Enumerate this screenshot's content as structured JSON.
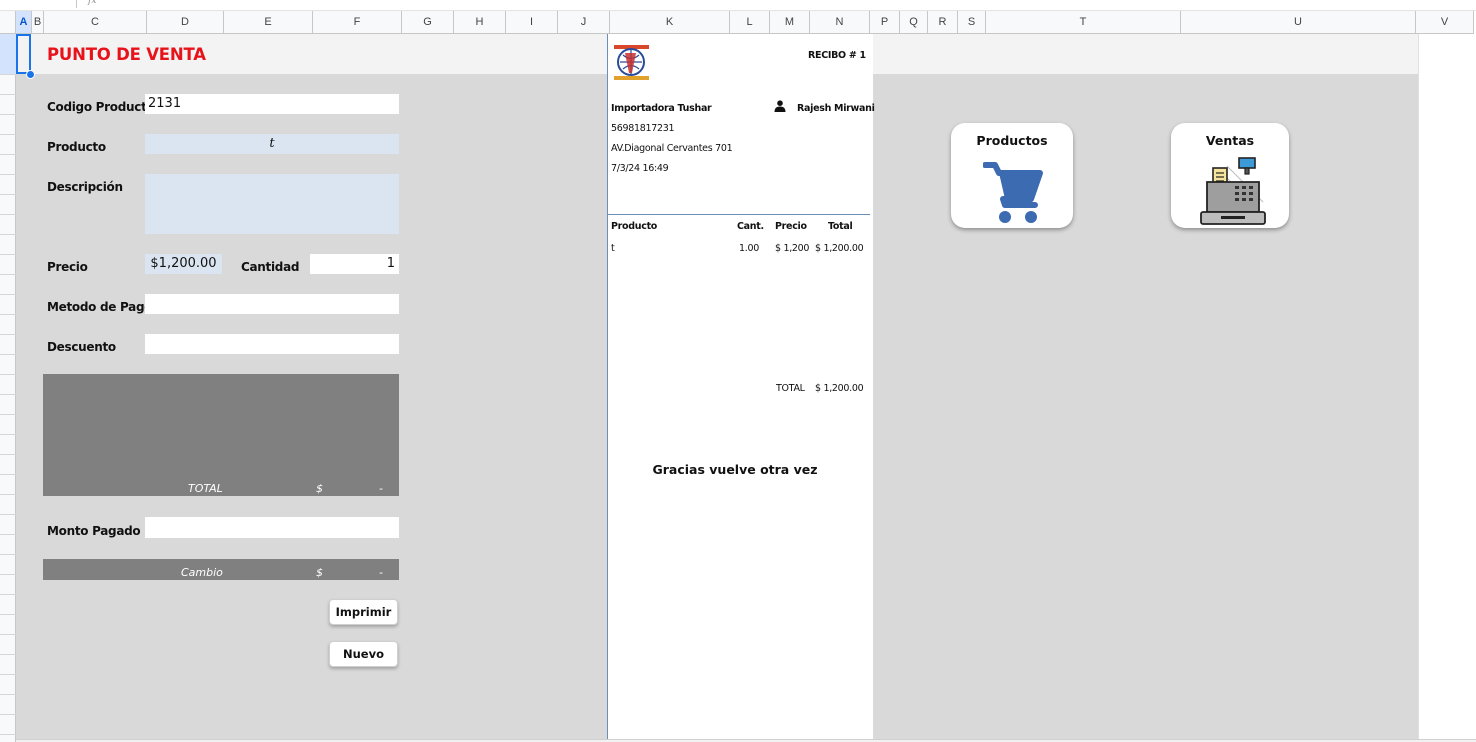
{
  "formula_bar": {
    "fx_label": "fx"
  },
  "columns": [
    "A",
    "B",
    "C",
    "D",
    "E",
    "F",
    "G",
    "H",
    "I",
    "J",
    "K",
    "L",
    "M",
    "N",
    "P",
    "Q",
    "R",
    "S",
    "T",
    "U",
    "V"
  ],
  "form": {
    "title": "PUNTO DE VENTA",
    "codigo_label": "Codigo Producto",
    "codigo_value": "2131",
    "producto_label": "Producto",
    "producto_value": "t",
    "descripcion_label": "Descripción",
    "descripcion_value": "",
    "precio_label": "Precio",
    "precio_value": "$1,200.00",
    "cantidad_label": "Cantidad",
    "cantidad_value": "1",
    "metodo_label": "Metodo de Pago",
    "metodo_value": "",
    "descuento_label": "Descuento",
    "descuento_value": "",
    "total_label": "TOTAL",
    "total_currency": "$",
    "total_value": "-",
    "monto_label": "Monto Pagado",
    "monto_value": "",
    "cambio_label": "Cambio",
    "cambio_currency": "$",
    "cambio_value": "-",
    "imprimir_label": "Imprimir",
    "nuevo_label": "Nuevo"
  },
  "receipt": {
    "recibo": "RECIBO # 1",
    "company": "Importadora Tushar",
    "phone": "56981817231",
    "address": "AV.Diagonal Cervantes 701",
    "datetime": "7/3/24 16:49",
    "user": "Rajesh Mirwani",
    "headers": {
      "producto": "Producto",
      "cant": "Cant.",
      "precio": "Precio",
      "total": "Total"
    },
    "items": [
      {
        "producto": "t",
        "cant": "1.00",
        "precio": "$ 1,200",
        "total": "$ 1,200.00"
      }
    ],
    "total_label": "TOTAL",
    "total_value": "$ 1,200.00",
    "thanks": "Gracias vuelve otra vez"
  },
  "nav": {
    "productos_label": "Productos",
    "ventas_label": "Ventas"
  },
  "colors": {
    "title": "#e8121b",
    "panel": "#d9d9d9",
    "dark_box": "#808080",
    "input_blue": "#dbe5f1",
    "cart": "#3c6bb2"
  }
}
